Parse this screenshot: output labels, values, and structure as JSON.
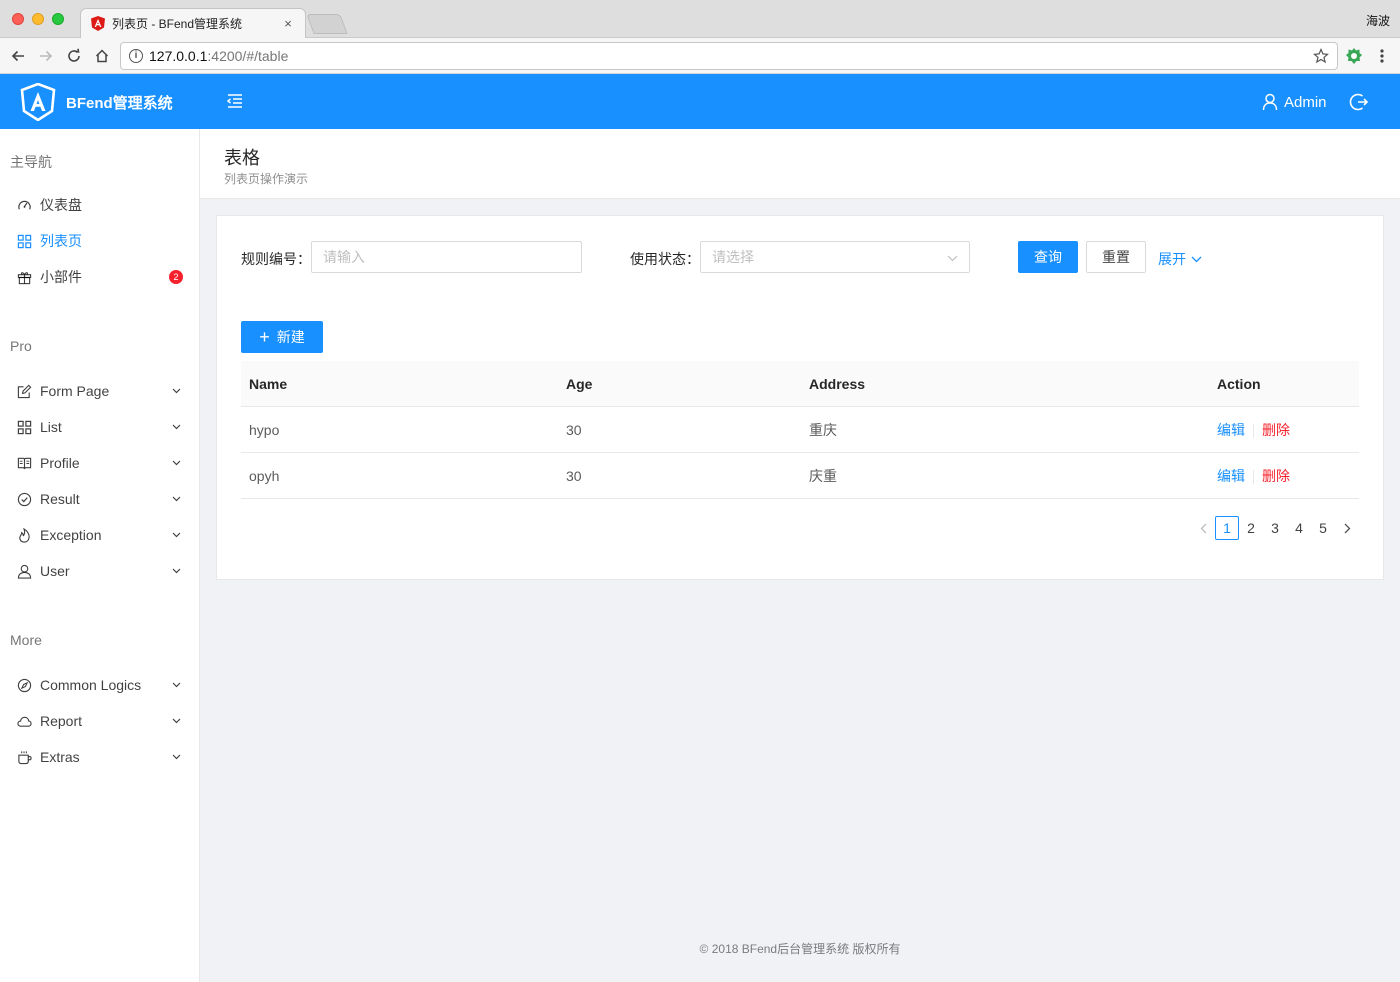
{
  "browser": {
    "tab_title": "列表页 - BFend管理系统",
    "close": "×",
    "user": "海波",
    "url_host": "127.0.0.1",
    "url_rest": ":4200/#/table",
    "info_glyph": "i"
  },
  "header": {
    "brand": "BFend管理系统",
    "user_name": "Admin"
  },
  "sidebar": {
    "groups": [
      {
        "title": "主导航"
      },
      {
        "title": "Pro"
      },
      {
        "title": "More"
      }
    ],
    "main_items": [
      {
        "label": "仪表盘",
        "icon": "dashboard-icon"
      },
      {
        "label": "列表页",
        "icon": "appstore-icon",
        "active": true
      },
      {
        "label": "小部件",
        "icon": "gift-icon",
        "badge": "2"
      }
    ],
    "pro_items": [
      {
        "label": "Form Page",
        "icon": "form-icon"
      },
      {
        "label": "List",
        "icon": "appstore-icon"
      },
      {
        "label": "Profile",
        "icon": "book-icon"
      },
      {
        "label": "Result",
        "icon": "check-circle-icon"
      },
      {
        "label": "Exception",
        "icon": "fire-icon"
      },
      {
        "label": "User",
        "icon": "user-icon"
      }
    ],
    "more_items": [
      {
        "label": "Common Logics",
        "icon": "compass-icon"
      },
      {
        "label": "Report",
        "icon": "cloud-icon"
      },
      {
        "label": "Extras",
        "icon": "coffee-icon"
      }
    ]
  },
  "page": {
    "title": "表格",
    "subtitle": "列表页操作演示"
  },
  "filters": {
    "rule_label": "规则编号：",
    "rule_placeholder": "请输入",
    "status_label": "使用状态：",
    "status_placeholder": "请选择",
    "query": "查询",
    "reset": "重置",
    "expand": "展开"
  },
  "actions": {
    "new_icon": "+",
    "new_label": "新建"
  },
  "table": {
    "columns": [
      "Name",
      "Age",
      "Address",
      "Action"
    ],
    "rows": [
      {
        "name": "hypo",
        "age": "30",
        "address": "重庆",
        "edit": "编辑",
        "delete": "删除"
      },
      {
        "name": "opyh",
        "age": "30",
        "address": "庆重",
        "edit": "编辑",
        "delete": "删除"
      }
    ]
  },
  "pagination": {
    "pages": [
      "1",
      "2",
      "3",
      "4",
      "5"
    ],
    "current": "1"
  },
  "footer": "© 2018 BFend后台管理系统 版权所有",
  "colors": {
    "primary": "#1890ff",
    "danger": "#f5222d"
  }
}
